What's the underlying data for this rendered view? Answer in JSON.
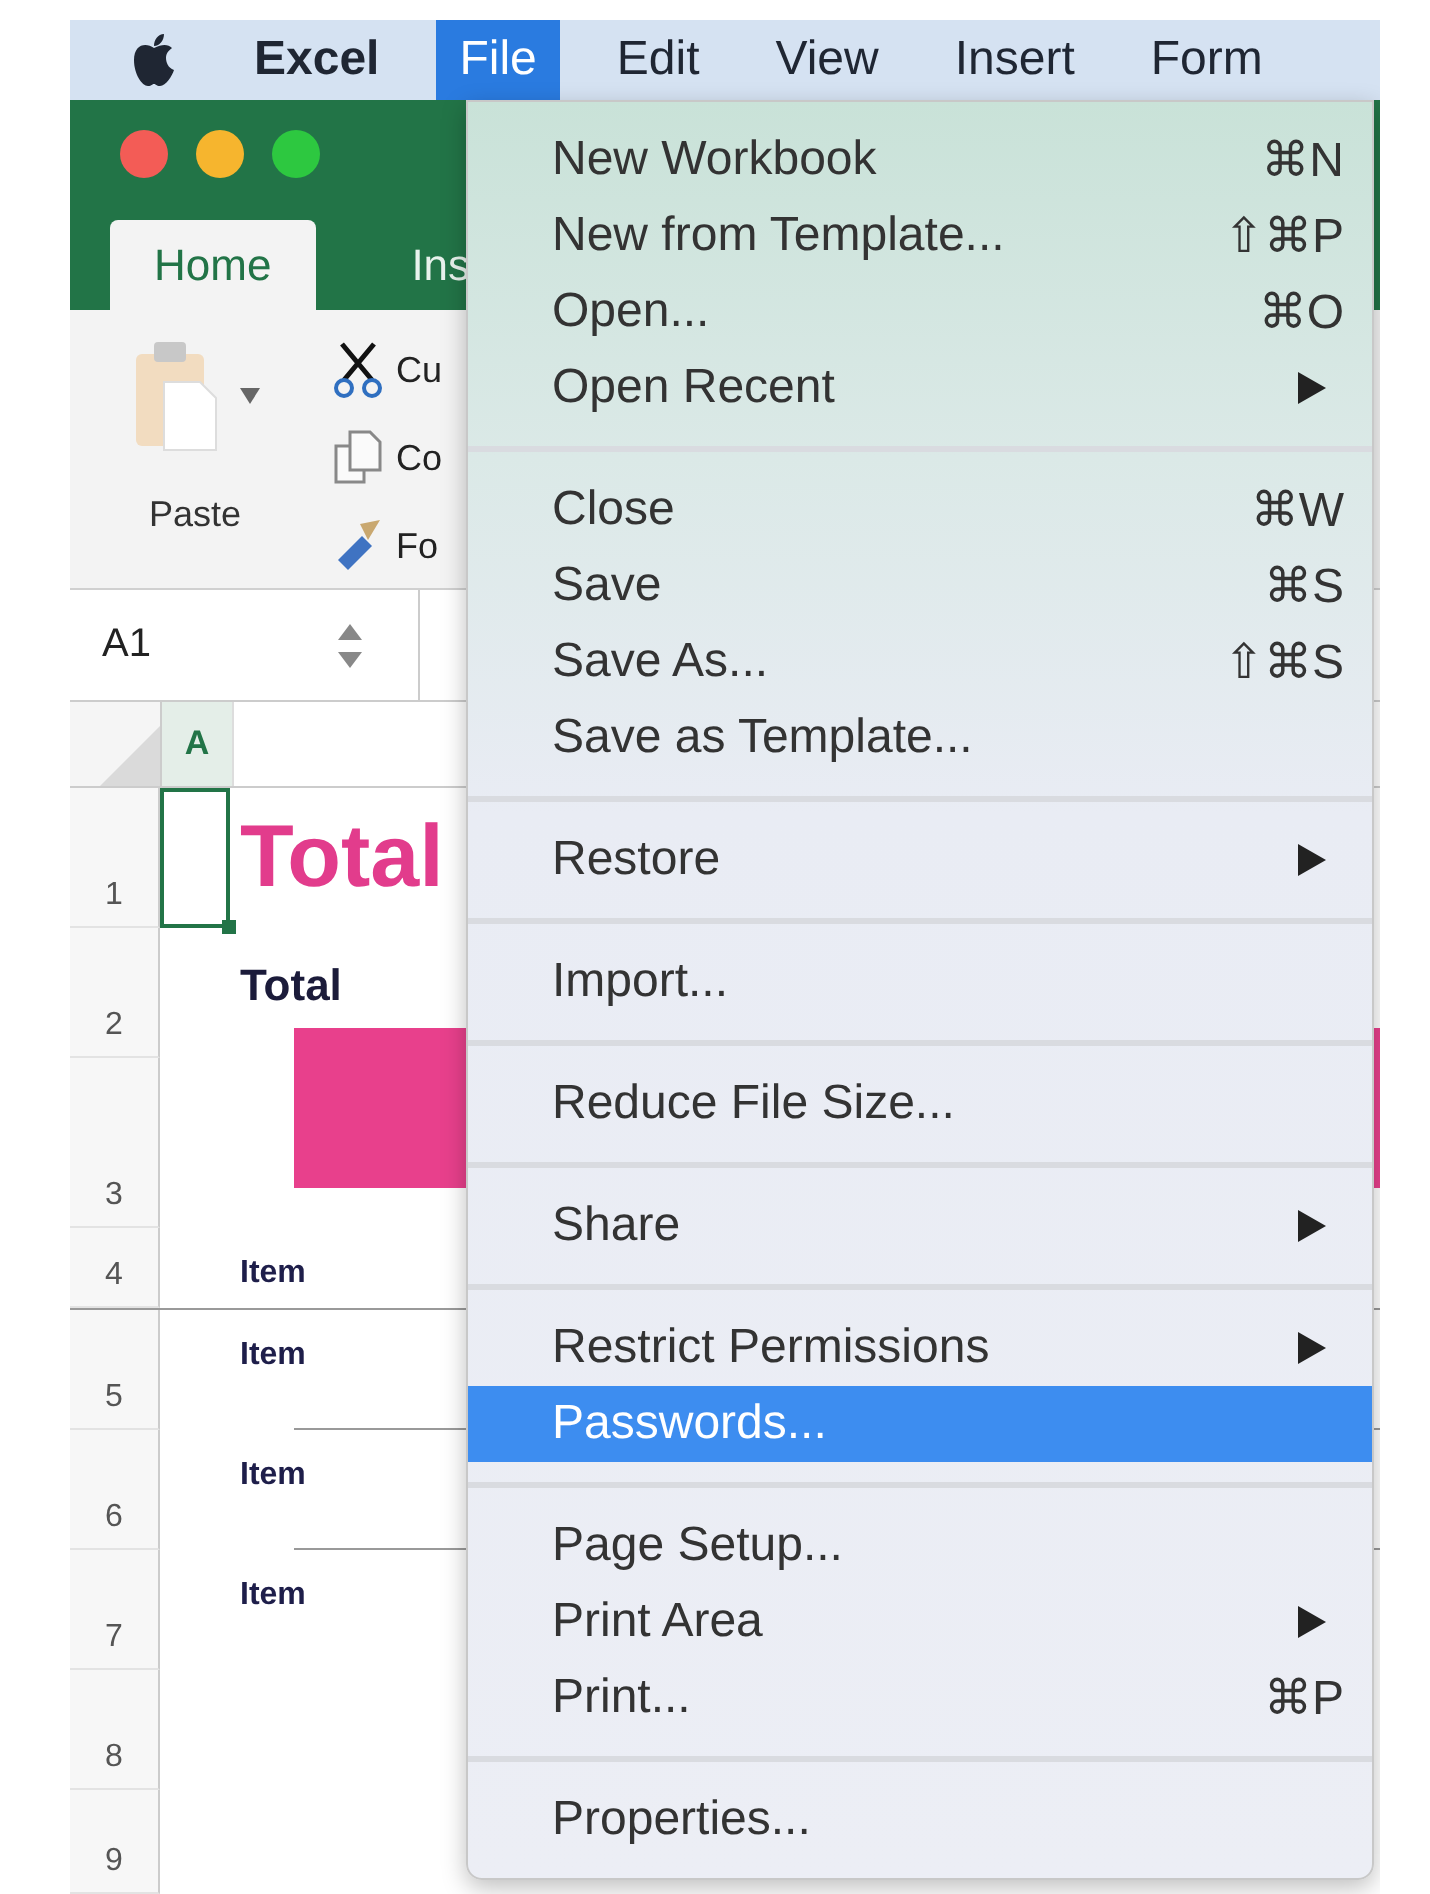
{
  "menu_bar": {
    "app_name": "Excel",
    "items": [
      {
        "label": "File",
        "selected": true
      },
      {
        "label": "Edit",
        "selected": false
      },
      {
        "label": "View",
        "selected": false
      },
      {
        "label": "Insert",
        "selected": false
      },
      {
        "label": "Form",
        "selected": false
      }
    ]
  },
  "window": {
    "tabs": [
      {
        "label": "Home",
        "selected": true
      },
      {
        "label": "Ins",
        "selected": false
      }
    ],
    "paste_label": "Paste",
    "clipboard_commands": [
      {
        "kind": "cut",
        "label": "Cu"
      },
      {
        "kind": "copy",
        "label": "Co"
      },
      {
        "kind": "format",
        "label": "Fo"
      }
    ],
    "name_box": "A1"
  },
  "grid": {
    "column_header": {
      "label": "A",
      "selected": true
    },
    "rows": [
      {
        "number": "1",
        "kind": "title",
        "text": "Total",
        "selected": true,
        "ruled": false
      },
      {
        "number": "2",
        "kind": "heading",
        "text": "Total",
        "selected": false,
        "ruled": false
      },
      {
        "number": "3",
        "kind": "block",
        "selected": false,
        "ruled": false
      },
      {
        "number": "4",
        "kind": "item",
        "text": "Item",
        "selected": false,
        "ruled": true
      },
      {
        "number": "5",
        "kind": "item",
        "text": "Item",
        "selected": false,
        "ruled": true
      },
      {
        "number": "6",
        "kind": "item",
        "text": "Item",
        "selected": false,
        "ruled": true
      },
      {
        "number": "7",
        "kind": "item",
        "text": "Item",
        "selected": false,
        "ruled": false
      },
      {
        "number": "8",
        "kind": "empty",
        "selected": false,
        "ruled": false
      },
      {
        "number": "9",
        "kind": "empty",
        "selected": false,
        "ruled": false
      }
    ]
  },
  "file_menu": {
    "groups": [
      [
        {
          "label": "New Workbook",
          "shortcut": "⌘N",
          "submenu": false,
          "selected": false
        },
        {
          "label": "New from Template...",
          "shortcut": "⇧⌘P",
          "submenu": false,
          "selected": false
        },
        {
          "label": "Open...",
          "shortcut": "⌘O",
          "submenu": false,
          "selected": false
        },
        {
          "label": "Open Recent",
          "submenu": true,
          "selected": false
        }
      ],
      [
        {
          "label": "Close",
          "shortcut": "⌘W",
          "submenu": false,
          "selected": false
        },
        {
          "label": "Save",
          "shortcut": "⌘S",
          "submenu": false,
          "selected": false
        },
        {
          "label": "Save As...",
          "shortcut": "⇧⌘S",
          "submenu": false,
          "selected": false
        },
        {
          "label": "Save as Template...",
          "submenu": false,
          "selected": false
        }
      ],
      [
        {
          "label": "Restore",
          "submenu": true,
          "selected": false
        }
      ],
      [
        {
          "label": "Import...",
          "submenu": false,
          "selected": false
        }
      ],
      [
        {
          "label": "Reduce File Size...",
          "submenu": false,
          "selected": false
        }
      ],
      [
        {
          "label": "Share",
          "submenu": true,
          "selected": false
        }
      ],
      [
        {
          "label": "Restrict Permissions",
          "submenu": true,
          "selected": false
        },
        {
          "label": "Passwords...",
          "submenu": false,
          "selected": true
        }
      ],
      [
        {
          "label": "Page Setup...",
          "submenu": false,
          "selected": false
        },
        {
          "label": "Print Area",
          "submenu": true,
          "selected": false
        },
        {
          "label": "Print...",
          "shortcut": "⌘P",
          "submenu": false,
          "selected": false
        }
      ],
      [
        {
          "label": "Properties...",
          "submenu": false,
          "selected": false
        }
      ]
    ]
  }
}
